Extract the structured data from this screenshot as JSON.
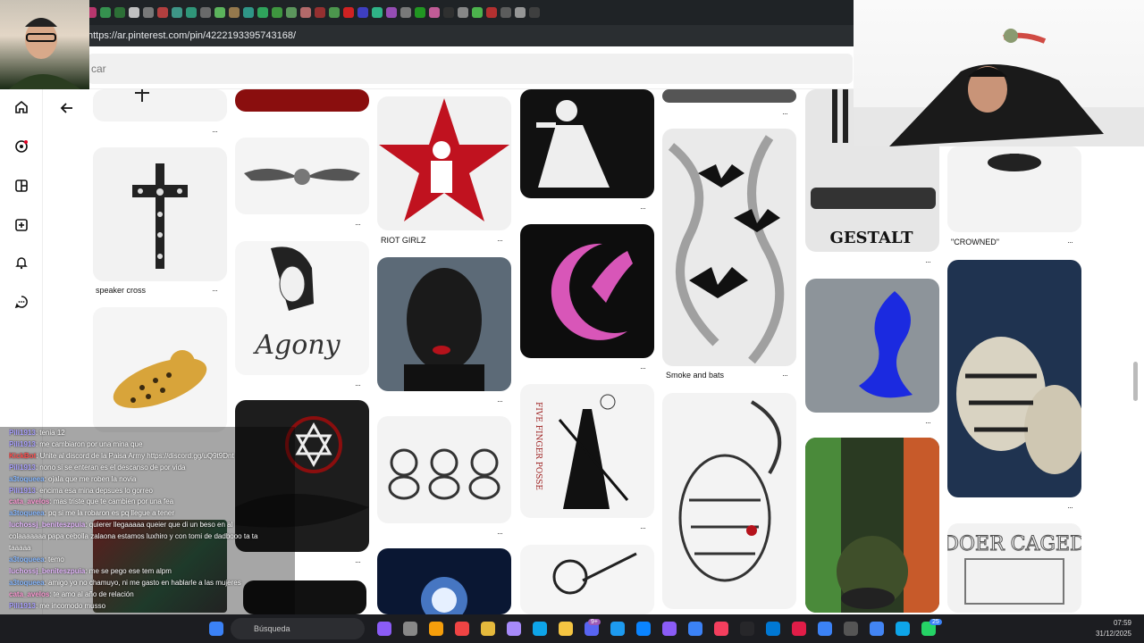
{
  "browser": {
    "url": "https://ar.pinterest.com/pin/4222193395743168/",
    "search_placeholder": "car"
  },
  "sidebar": {
    "items": [
      {
        "name": "home",
        "icon": "home-icon",
        "glyph": "⌂"
      },
      {
        "name": "explore",
        "icon": "compass-icon",
        "glyph": "⊘"
      },
      {
        "name": "boards",
        "icon": "boards-icon",
        "glyph": "▣"
      },
      {
        "name": "create",
        "icon": "plus-square-icon",
        "glyph": "⊞"
      },
      {
        "name": "notifications",
        "icon": "bell-icon",
        "glyph": "🔔"
      },
      {
        "name": "messages",
        "icon": "chat-icon",
        "glyph": "💬"
      }
    ],
    "back_glyph": "←"
  },
  "pins": [
    {
      "caption": "speaker cross",
      "dots": "···"
    },
    {
      "caption": "RIOT GIRLZ",
      "dots": "···"
    },
    {
      "caption": "Smoke and bats",
      "dots": "···"
    },
    {
      "caption": "\"CROWNED\"",
      "dots": "···"
    },
    {
      "caption": "GESTALT"
    },
    {
      "caption": "Agony"
    },
    {
      "caption": "FIVE FINGER POSSE"
    },
    {
      "caption": "DOER CAGED"
    }
  ],
  "chat": {
    "messages": [
      {
        "user": "Pili1913",
        "text": ": tenia 12"
      },
      {
        "user": "Pili1913",
        "text": ": me cambiaron por una mina que"
      },
      {
        "user": "KickBot",
        "text": ": Unite al discord de la Paisa Army https://discord.gg/uQ9t9Dnt"
      },
      {
        "user": "Pili1913",
        "text": ": nono si se enteran es el descanso de por vida"
      },
      {
        "user": "a3toqueea",
        "text": ": ojala que me roben la novia"
      },
      {
        "user": "Pili1913",
        "text": ": encima esa mina depsues lo gorreo"
      },
      {
        "user": "cata_avelos",
        "text": ": mas triste que te cambien por una fea"
      },
      {
        "user": "a3toqueea",
        "text": ": pq si me la robaron es pq llegue a tener"
      },
      {
        "user": "luchossj_beniteszpuia",
        "text": ": quierer llegaaaaa queier que di un beso en al"
      },
      {
        "user": "",
        "text": "colaaaaaaa papa cebolla zalaona estamos luxhiro y con tomi de dadbooo ta ta"
      },
      {
        "user": "",
        "text": "taaaaa"
      },
      {
        "user": "a3toqueea",
        "text": ": temo"
      },
      {
        "user": "luchossj_beniteszpuia",
        "text": ": me se pego ese tem alpm"
      },
      {
        "user": "a3toqueea",
        "text": ": amigo yo no chamuyo, ni me gasto en hablarle a las mujeres"
      },
      {
        "user": "cata_avelos",
        "text": ": te amo al año de relación"
      },
      {
        "user": "Pili1913",
        "text": ": me incomodo musso"
      }
    ]
  },
  "taskbar": {
    "search_label": "Búsqueda",
    "time": "07:59",
    "date": "31/12/2025",
    "badge_a": "9+",
    "badge_b": "25"
  }
}
